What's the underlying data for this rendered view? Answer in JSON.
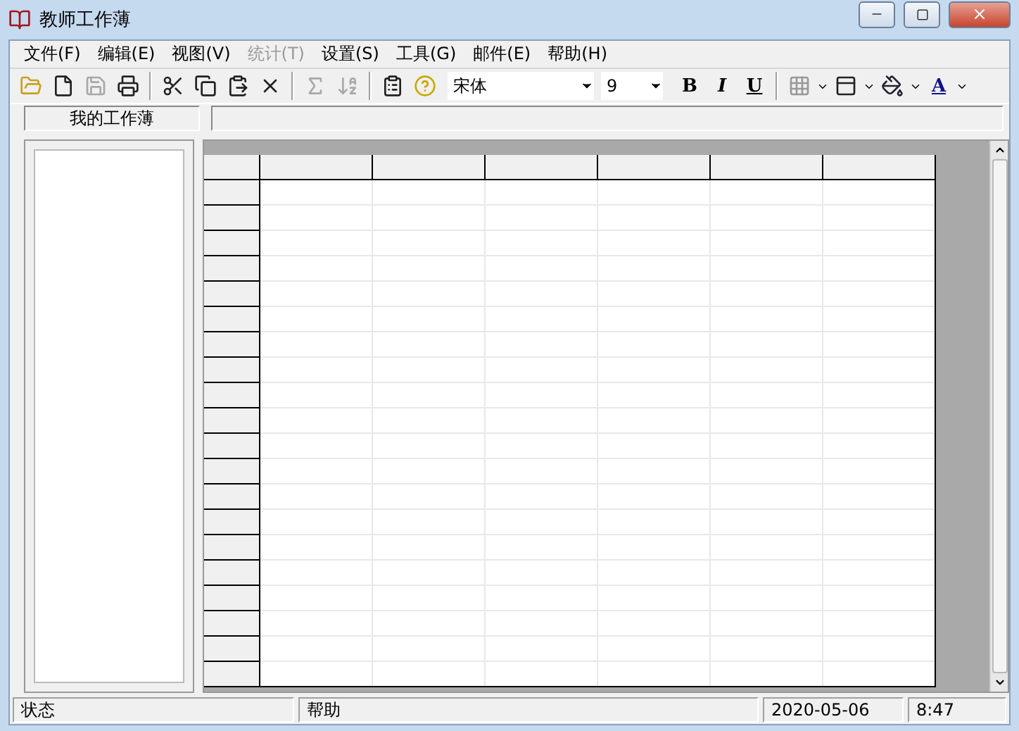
{
  "window": {
    "title": "教师工作薄"
  },
  "menu": [
    {
      "label": "文件(F)",
      "disabled": false
    },
    {
      "label": "编辑(E)",
      "disabled": false
    },
    {
      "label": "视图(V)",
      "disabled": false
    },
    {
      "label": "统计(T)",
      "disabled": true
    },
    {
      "label": "设置(S)",
      "disabled": false
    },
    {
      "label": "工具(G)",
      "disabled": false
    },
    {
      "label": "邮件(E)",
      "disabled": false
    },
    {
      "label": "帮助(H)",
      "disabled": false
    }
  ],
  "toolbar": {
    "groups": [
      [
        {
          "kind": "open",
          "disabled": false
        },
        {
          "kind": "new",
          "disabled": false
        },
        {
          "kind": "save",
          "disabled": true
        },
        {
          "kind": "print",
          "disabled": false
        }
      ],
      [
        {
          "kind": "cut",
          "disabled": false
        },
        {
          "kind": "copy",
          "disabled": false
        },
        {
          "kind": "paste",
          "disabled": false
        },
        {
          "kind": "delete",
          "disabled": false
        }
      ],
      [
        {
          "kind": "sum",
          "disabled": true
        },
        {
          "kind": "sort",
          "disabled": true
        }
      ],
      [
        {
          "kind": "properties",
          "disabled": false
        },
        {
          "kind": "help",
          "disabled": false
        }
      ]
    ],
    "font": "宋体",
    "size": "9",
    "styles": [
      {
        "kind": "bold",
        "label": "B"
      },
      {
        "kind": "italic",
        "label": "I"
      },
      {
        "kind": "underline",
        "label": "U"
      }
    ],
    "font_color_label": "A"
  },
  "workbook_label": "我的工作薄",
  "status_bar": [
    "状态",
    "帮助",
    "2020-05-06",
    "8:47"
  ]
}
